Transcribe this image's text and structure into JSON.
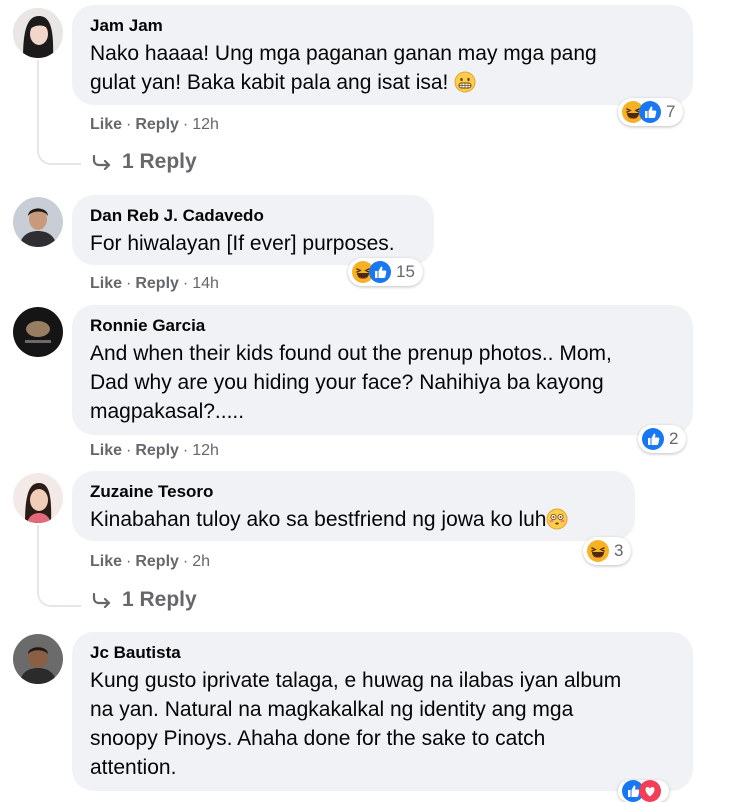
{
  "comments": [
    {
      "author": "Jam Jam",
      "text_lines": [
        "Nako haaaa! Ung mga paganan ganan may mga pang",
        "gulat yan! Baka kabit pala ang isat isa!"
      ],
      "emoji": "grin-emoji",
      "actions": {
        "like": "Like",
        "reply": "Reply",
        "time": "12h"
      },
      "reactions": {
        "icons": [
          "haha-icon",
          "like-icon"
        ],
        "count": "7"
      },
      "replies_link": "1 Reply"
    },
    {
      "author": "Dan Reb J. Cadavedo",
      "text_lines": [
        "For hiwalayan [If ever] purposes."
      ],
      "actions": {
        "like": "Like",
        "reply": "Reply",
        "time": "14h"
      },
      "reactions": {
        "icons": [
          "haha-icon",
          "like-icon"
        ],
        "count": "15"
      }
    },
    {
      "author": "Ronnie Garcia",
      "text_lines": [
        "And when their kids found out the prenup photos.. Mom,",
        "Dad why are you hiding your face? Nahihiya ba kayong",
        "magpakasal?....."
      ],
      "actions": {
        "like": "Like",
        "reply": "Reply",
        "time": "12h"
      },
      "reactions": {
        "icons": [
          "like-icon"
        ],
        "count": "2"
      }
    },
    {
      "author": "Zuzaine Tesoro",
      "text_lines": [
        "Kinabahan tuloy ako sa bestfriend ng jowa ko luh"
      ],
      "emoji": "flushed-emoji",
      "actions": {
        "like": "Like",
        "reply": "Reply",
        "time": "2h"
      },
      "reactions": {
        "icons": [
          "haha-icon"
        ],
        "count": "3"
      },
      "replies_link": "1 Reply"
    },
    {
      "author": "Jc Bautista",
      "text_lines": [
        "Kung gusto iprivate talaga, e huwag na ilabas iyan album",
        "na yan. Natural na magkakalkal ng identity ang mga",
        "snoopy Pinoys. Ahaha done for the sake to catch",
        "attention."
      ],
      "reactions": {
        "icons": [
          "like-icon",
          "love-icon"
        ],
        "count": ""
      }
    }
  ],
  "separator": "·",
  "colors": {
    "bubble": "#f0f2f5",
    "meta": "#65676b",
    "like": "#1877f2",
    "haha": "#f7b125",
    "love": "#f33e58"
  }
}
